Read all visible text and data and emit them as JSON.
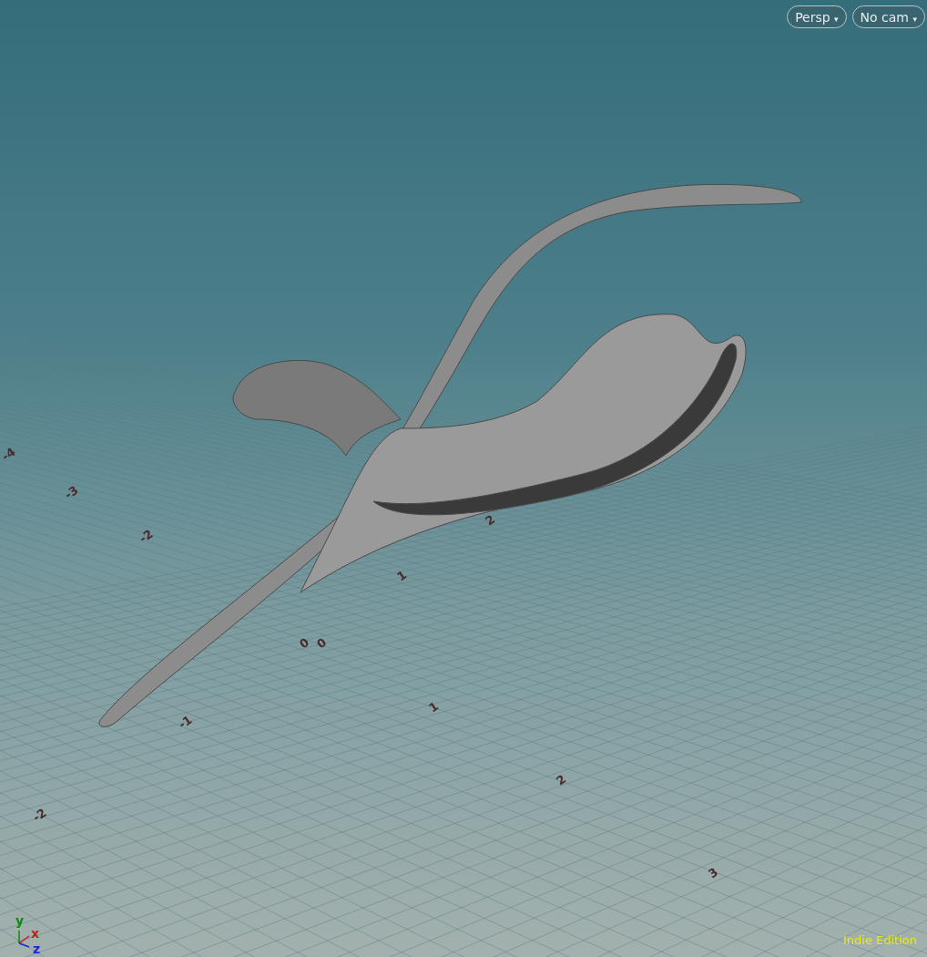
{
  "viewport": {
    "view_menus": [
      {
        "label": "Persp",
        "caret": "▾"
      },
      {
        "label": "No cam",
        "caret": "▾"
      }
    ],
    "grid_labels": [
      "0",
      "0",
      "1",
      "2",
      "3",
      "1",
      "2",
      "-1",
      "-2",
      "-2",
      "-3",
      "-4"
    ],
    "axis_labels": [
      {
        "label": "y",
        "color": "#0f8a0f"
      },
      {
        "label": "x",
        "color": "#d01818"
      },
      {
        "label": "z",
        "color": "#1a2ad8"
      }
    ],
    "edition": "Indie Edition"
  }
}
